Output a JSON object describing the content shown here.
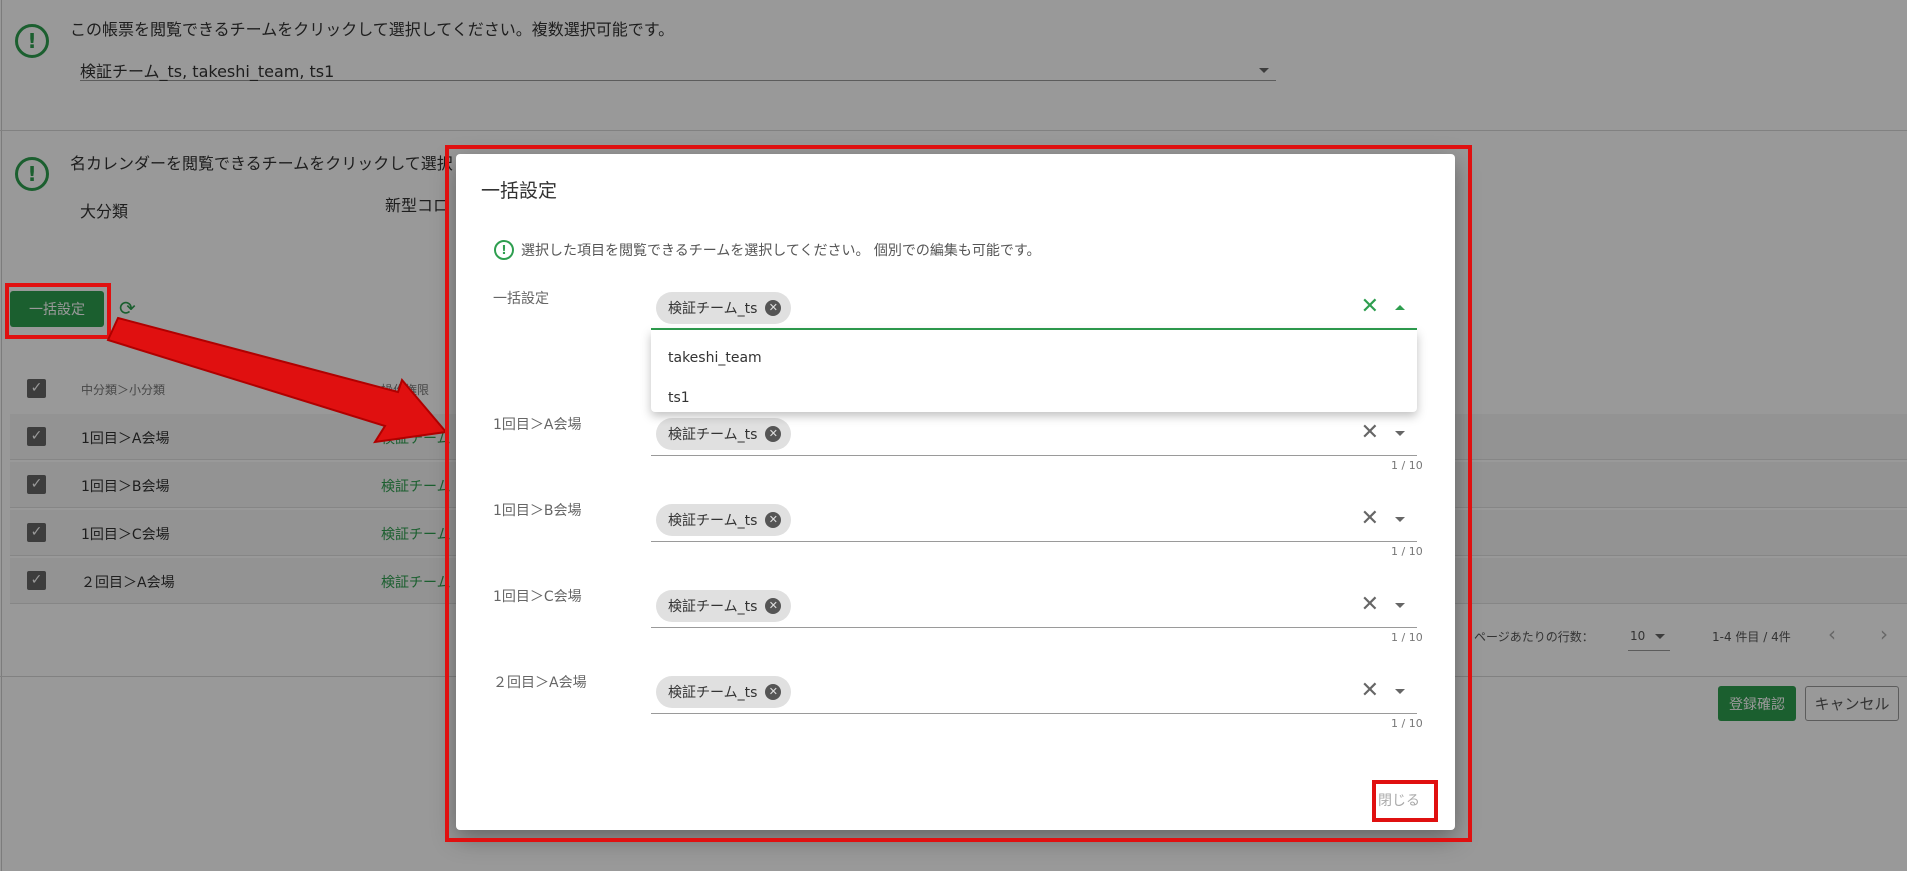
{
  "background": {
    "section1": {
      "text": "この帳票を閲覧できるチームをクリックして選択してください。複数選択可能です。",
      "select_value": "検証チーム_ts, takeshi_team, ts1"
    },
    "section2": {
      "text": "名カレンダーを閲覧できるチームをクリックして選択してください。複数選択可能です。",
      "text_visible": "名カレンダーを閲覧できるチームをクリックして選択",
      "category_label": "大分類",
      "category_value": "新型コロ"
    },
    "bulk_button_label": "一括設定",
    "table": {
      "headers": [
        "中分類＞小分類",
        "操作権限"
      ],
      "rows": [
        {
          "label": "1回目＞A会場",
          "teams": "検証チーム"
        },
        {
          "label": "1回目＞B会場",
          "teams": "検証チーム"
        },
        {
          "label": "1回目＞C会場",
          "teams": "検証チーム"
        },
        {
          "label": "２回目＞A会場",
          "teams": "検証チーム"
        }
      ]
    },
    "pager": {
      "rows_per_page_label": "ページあたりの行数：",
      "rows_per_page_value": "10",
      "range_text": "1-4 件目 / 4件"
    },
    "confirm_button": "登録確認",
    "cancel_button": "キャンセル"
  },
  "dialog": {
    "title": "一括設定",
    "info_text": "選択した項目を閲覧できるチームを選択してください。 個別での編集も可能です。",
    "bulk_field": {
      "label": "一括設定",
      "chip": "検証チーム_ts"
    },
    "dropdown_options": [
      "takeshi_team",
      "ts1"
    ],
    "rows": [
      {
        "label": "1回目＞A会場",
        "chip": "検証チーム_ts",
        "counter": "1 / 10"
      },
      {
        "label": "1回目＞B会場",
        "chip": "検証チーム_ts",
        "counter": "1 / 10"
      },
      {
        "label": "1回目＞C会場",
        "chip": "検証チーム_ts",
        "counter": "1 / 10"
      },
      {
        "label": "２回目＞A会場",
        "chip": "検証チーム_ts",
        "counter": "1 / 10"
      }
    ],
    "close_button": "閉じる"
  },
  "colors": {
    "accent_green": "#2e9e4f",
    "highlight_red": "#e01010",
    "overlay": "rgba(0,0,0,0.40)"
  },
  "icons": {
    "info": "exclamation-circle-icon",
    "refresh": "refresh-icon",
    "chip_remove": "cancel-circle-icon",
    "clear": "close-icon",
    "dropdown": "caret-down-icon",
    "pager_prev": "chevron-left-icon",
    "pager_next": "chevron-right-icon"
  }
}
